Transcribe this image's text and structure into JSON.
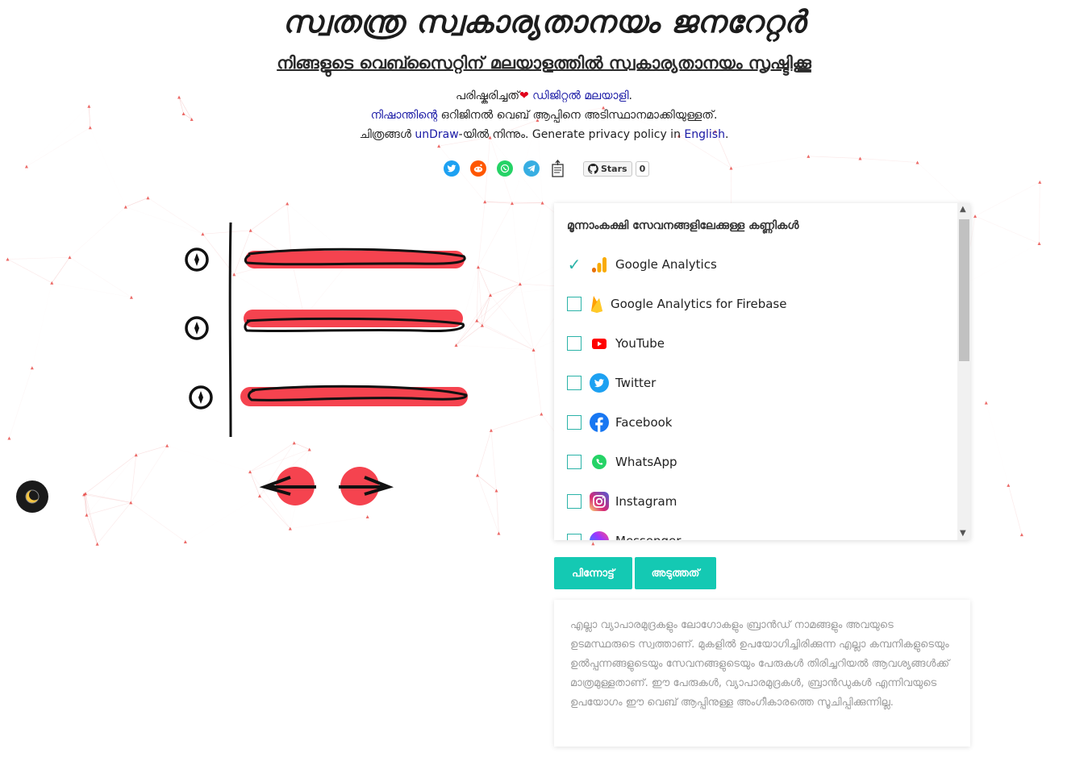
{
  "header": {
    "title": "സ്വതന്ത്ര സ്വകാര്യതാനയം ജനറേറ്റർ",
    "subtitle": "നിങ്ങളുടെ വെബ്സൈറ്റിന് മലയാളത്തിൽ സ്വകാര്യതാനയം സൃഷ്ടിക്കൂ"
  },
  "credits": {
    "line1_prefix": "പരിഷ്കരിച്ചത്",
    "line1_link": "ഡിജിറ്റൽ മലയാളി",
    "line1_suffix": ".",
    "line2_link": "നിഷാന്തിന്റെ",
    "line2_text": " ഒറിജിനൽ വെബ് ആപ്പിനെ അടിസ്ഥാനമാക്കിയുള്ളത്.",
    "line3_prefix": "ചിത്രങ്ങൾ ",
    "line3_link": "unDraw",
    "line3_mid": "-യിൽ നിന്നും. Generate privacy policy in ",
    "line3_link2": "English",
    "line3_suffix": "."
  },
  "github": {
    "label": "Stars",
    "count": "0"
  },
  "services_panel": {
    "title": "മൂന്നാംകക്ഷി സേവനങ്ങളിലേക്കുള്ള കണ്ണികൾ",
    "items": [
      {
        "label": "Google Analytics",
        "checked": true,
        "icon": "google-analytics-icon"
      },
      {
        "label": "Google Analytics for Firebase",
        "checked": false,
        "icon": "firebase-icon"
      },
      {
        "label": "YouTube",
        "checked": false,
        "icon": "youtube-icon"
      },
      {
        "label": "Twitter",
        "checked": false,
        "icon": "twitter-icon"
      },
      {
        "label": "Facebook",
        "checked": false,
        "icon": "facebook-icon"
      },
      {
        "label": "WhatsApp",
        "checked": false,
        "icon": "whatsapp-icon"
      },
      {
        "label": "Instagram",
        "checked": false,
        "icon": "instagram-icon"
      },
      {
        "label": "Messenger",
        "checked": false,
        "icon": "messenger-icon"
      }
    ]
  },
  "buttons": {
    "back": "പിന്നോട്ട്",
    "next": "അടുത്തത്"
  },
  "disclaimer": "എല്ലാ വ്യാപാരമുദ്രകളും ലോഗോകളും ബ്രാൻഡ് നാമങ്ങളും അവയുടെ ഉടമസ്ഥരുടെ സ്വത്താണ്. മുകളിൽ ഉപയോഗിച്ചിരിക്കുന്ന എല്ലാ കമ്പനികളുടെയും ഉൽപ്പന്നങ്ങളുടെയും സേവനങ്ങളുടെയും പേരുകൾ തിരിച്ചറിയൽ ആവശ്യങ്ങൾക്ക് മാത്രമുള്ളതാണ്. ഈ പേരുകൾ, വ്യാപാരമുദ്രകൾ, ബ്രാൻഡുകൾ എന്നിവയുടെ ഉപയോഗം ഈ വെബ് ആപ്പിനുള്ള അംഗീകാരത്തെ സൂചിപ്പിക്കുന്നില്ല.",
  "colors": {
    "accent": "#14c9b3",
    "illustration_red": "#f5434f",
    "link": "#1a1aa6"
  }
}
